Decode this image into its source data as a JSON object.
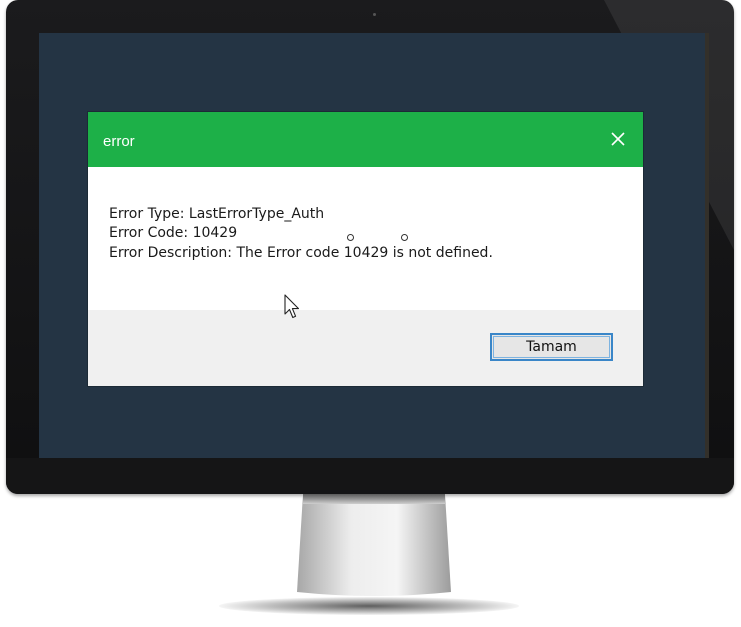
{
  "dialog": {
    "title": "error",
    "close_glyph": "✕",
    "lines": [
      "Error Type: LastErrorType_Auth",
      "Error Code: 10429",
      "Error Description: The Error code 10429 is not defined."
    ],
    "ok_label": "Tamam"
  },
  "colors": {
    "titlebar": "#1db048",
    "screen": "#243444",
    "button_border": "#3a86c8"
  },
  "icons": {
    "close": "close-icon",
    "cursor": "mouse-pointer-icon"
  }
}
